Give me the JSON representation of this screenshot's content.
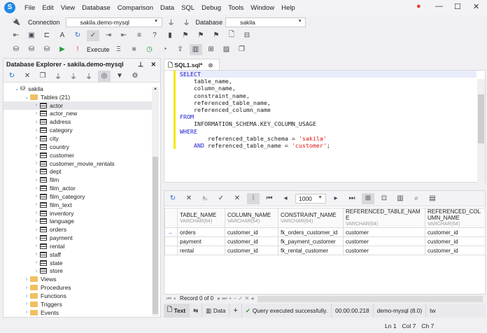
{
  "menu": [
    "File",
    "Edit",
    "View",
    "Database",
    "Comparison",
    "Data",
    "SQL",
    "Debug",
    "Tools",
    "Window",
    "Help"
  ],
  "toolbar": {
    "connection_label": "Connection",
    "connection_value": "sakila.demo-mysql",
    "database_label": "Database",
    "database_value": "sakila",
    "execute_label": "Execute"
  },
  "explorer": {
    "title": "Database Explorer - sakila.demo-mysql",
    "db": "sakila",
    "tables_label": "Tables (21)",
    "tables": [
      "actor",
      "actor_new",
      "address",
      "category",
      "city",
      "country",
      "customer",
      "customer_movie_rentals",
      "dept",
      "film",
      "film_actor",
      "film_category",
      "film_text",
      "inventory",
      "language",
      "orders",
      "payment",
      "rental",
      "staff",
      "state",
      "store"
    ],
    "folders": [
      "Views",
      "Procedures",
      "Functions",
      "Triggers",
      "Events"
    ]
  },
  "editor": {
    "tab": "SQL1.sql*"
  },
  "grid": {
    "page_size": "1000",
    "columns": [
      {
        "name": "TABLE_NAME",
        "type": "VARCHAR(64)"
      },
      {
        "name": "COLUMN_NAME",
        "type": "VARCHAR(64)"
      },
      {
        "name": "CONSTRAINT_NAME",
        "type": "VARCHAR(64)"
      },
      {
        "name": "REFERENCED_TABLE_NAME",
        "type": "VARCHAR(64)"
      },
      {
        "name": "REFERENCED_COLUMN_NAME",
        "type": "VARCHAR(64)"
      }
    ],
    "rows": [
      [
        "orders",
        "customer_id",
        "fk_orders_customer_id",
        "customer",
        "customer_id"
      ],
      [
        "payment",
        "customer_id",
        "fk_payment_customer",
        "customer",
        "customer_id"
      ],
      [
        "rental",
        "customer_id",
        "fk_rental_customer",
        "customer",
        "customer_id"
      ]
    ],
    "record": "Record 0 of 0"
  },
  "status": {
    "text_tab": "Text",
    "data_tab": "Data",
    "message": "Query executed successfully.",
    "time": "00:00:00.218",
    "server": "demo-mysql (8.0)",
    "user": "tw",
    "ln": "Ln 1",
    "col": "Col 7",
    "ch": "Ch 7"
  }
}
